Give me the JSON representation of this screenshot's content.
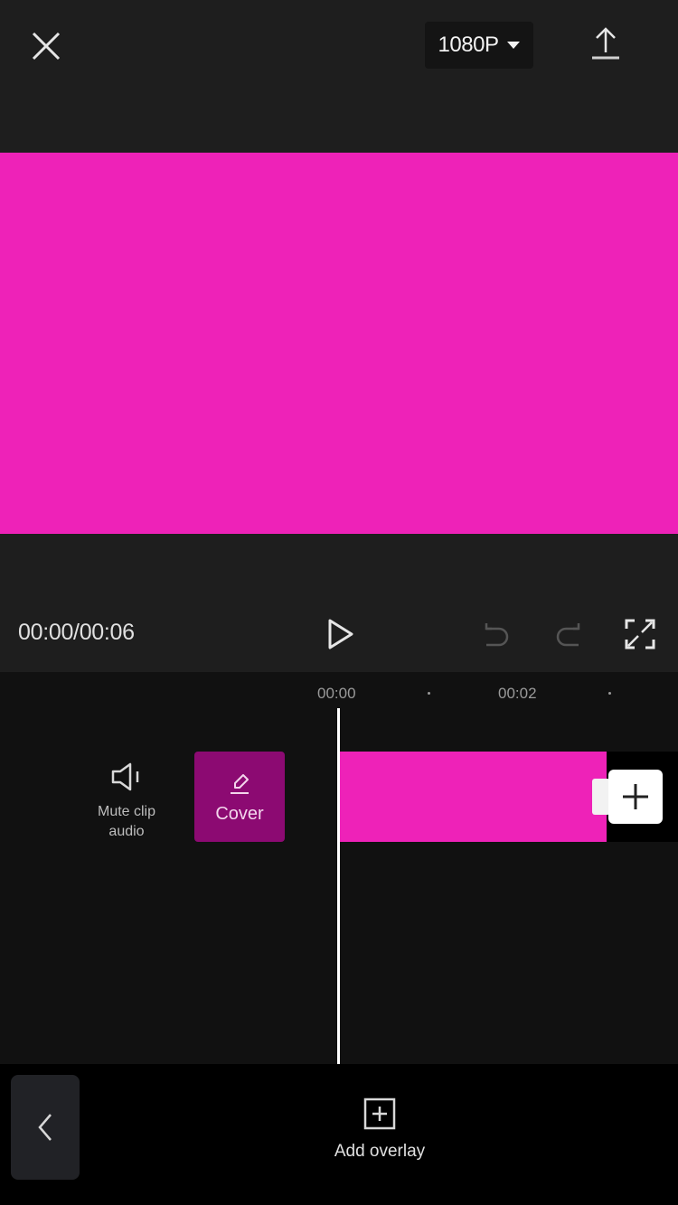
{
  "header": {
    "close_icon": "close-icon",
    "resolution": "1080P",
    "resolution_icon": "caret-down-icon",
    "export_icon": "export-upload-icon"
  },
  "preview": {
    "fill_color": "#ee22b8"
  },
  "controls": {
    "timecode": "00:00/00:06",
    "play_icon": "play-icon",
    "undo_icon": "undo-icon",
    "redo_icon": "redo-icon",
    "fullscreen_icon": "fullscreen-icon"
  },
  "timeline": {
    "ticks": [
      "00:00",
      "00:02"
    ],
    "mute_label": "Mute clip audio",
    "mute_label_line1": "Mute clip",
    "mute_label_line2": "audio",
    "cover_label": "Cover",
    "cover_color": "#8c0a72",
    "clip_color": "#ee22b8",
    "add_clip_icon": "plus-icon"
  },
  "bottom": {
    "back_icon": "chevron-left-icon",
    "add_overlay_label": "Add overlay",
    "add_overlay_icon": "add-overlay-icon"
  }
}
